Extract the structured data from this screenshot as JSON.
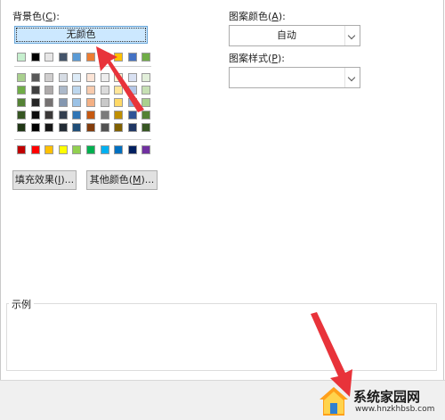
{
  "background": {
    "label_main": "背景色(",
    "label_key": "C",
    "label_end": "):",
    "no_color_label": "无颜色",
    "palette": {
      "top_row": [
        "#c6efce",
        "#000000",
        "#e7e6e6",
        "#44546a",
        "#5b9bd5",
        "#ed7d31",
        "#a5a5a5",
        "#ffc000",
        "#4472c4",
        "#70ad47"
      ],
      "theme_rows": [
        [
          "#a9d08e",
          "#595959",
          "#d0cece",
          "#d6dce4",
          "#ddebf7",
          "#fce4d6",
          "#ededed",
          "#fff2cc",
          "#d9e1f2",
          "#e2efda"
        ],
        [
          "#70ad47",
          "#404040",
          "#aeaaaa",
          "#acb9ca",
          "#bdd7ee",
          "#f8cbad",
          "#dbdbdb",
          "#ffe699",
          "#b4c6e7",
          "#c6e0b4"
        ],
        [
          "#548235",
          "#262626",
          "#757171",
          "#8497b0",
          "#9bc2e6",
          "#f4b084",
          "#c9c9c9",
          "#ffd966",
          "#8ea9db",
          "#a9d08e"
        ],
        [
          "#375623",
          "#0d0d0d",
          "#3a3838",
          "#333f4f",
          "#2f75b5",
          "#c65911",
          "#7b7b7b",
          "#bf8f00",
          "#305496",
          "#548235"
        ],
        [
          "#203715",
          "#000000",
          "#161616",
          "#222b35",
          "#1f4e78",
          "#833c0c",
          "#525252",
          "#806000",
          "#203764",
          "#375623"
        ]
      ],
      "standard_row": [
        "#c00000",
        "#ff0000",
        "#ffc000",
        "#ffff00",
        "#92d050",
        "#00b050",
        "#00b0f0",
        "#0070c0",
        "#002060",
        "#7030a0"
      ]
    },
    "fill_effects": {
      "label": "填充效果(",
      "key": "I",
      "end": ")..."
    },
    "more_colors": {
      "label": "其他颜色(",
      "key": "M",
      "end": ")..."
    }
  },
  "pattern_color": {
    "label": "图案颜色(",
    "key": "A",
    "end": "):",
    "value": "自动"
  },
  "pattern_style": {
    "label": "图案样式(",
    "key": "P",
    "end": "):",
    "value": ""
  },
  "sample": {
    "title": "示例"
  },
  "watermark": {
    "name": "系统家园网",
    "url": "www.hnzkhbsb.com"
  },
  "colors": {
    "accent_arrow": "#e8333a",
    "selected_bg": "#cce8ff"
  }
}
